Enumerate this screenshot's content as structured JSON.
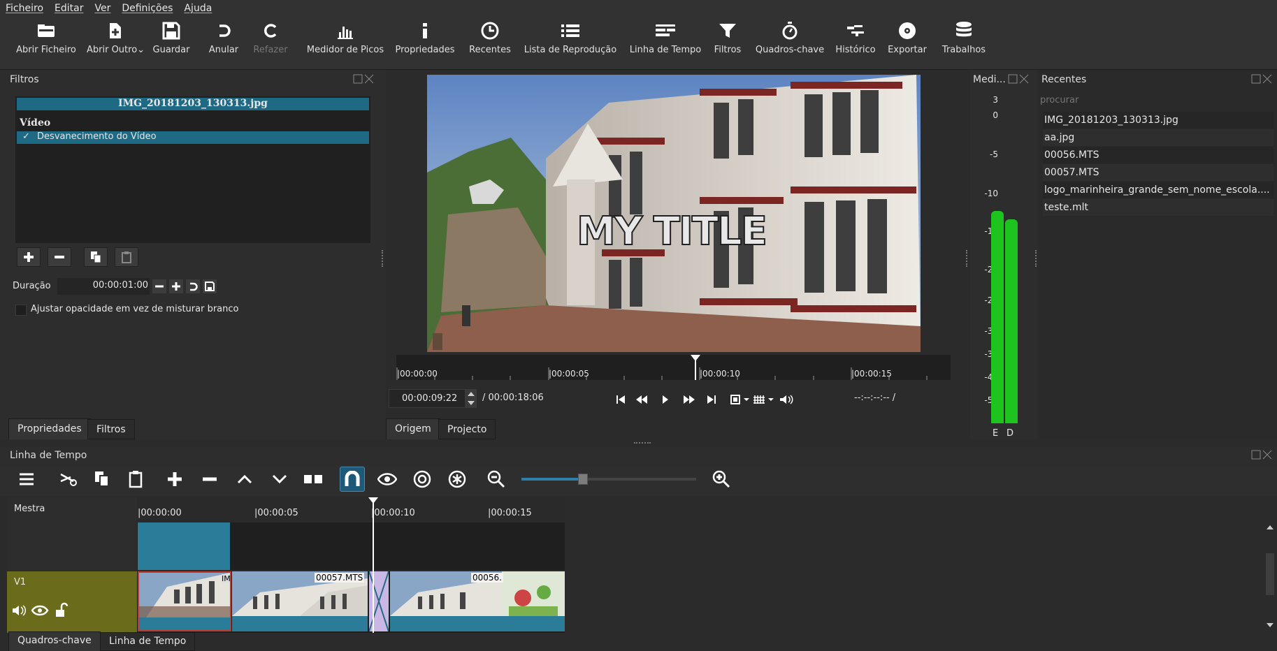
{
  "menu": [
    "Ficheiro",
    "Editar",
    "Ver",
    "Definições",
    "Ajuda"
  ],
  "toolbar": {
    "open_file": "Abrir Ficheiro",
    "open_other": "Abrir Outro",
    "save": "Guardar",
    "undo": "Anular",
    "redo": "Refazer",
    "peak_meter": "Medidor de Picos",
    "properties": "Propriedades",
    "recent": "Recentes",
    "playlist": "Lista de Reprodução",
    "timeline": "Linha de Tempo",
    "filters": "Filtros",
    "keyframes": "Quadros-chave",
    "history": "Histórico",
    "export": "Exportar",
    "jobs": "Trabalhos"
  },
  "filters_panel": {
    "title": "Filtros",
    "clip_name": "IMG_20181203_130313.jpg",
    "section": "Vídeo",
    "filter_item": "Desvanecimento do Vídeo",
    "check": "✓",
    "duration_label": "Duração",
    "duration_value": "00:00:01:00",
    "opacity_option": "Ajustar opacidade em vez de misturar branco",
    "tabs": [
      "Propriedades",
      "Filtros"
    ]
  },
  "player": {
    "title_overlay": "MY TITLE",
    "ruler_labels": [
      "|00:00:00",
      "|00:00:05",
      "|00:00:10",
      "|00:00:15"
    ],
    "position": "00:00:09:22",
    "duration": "/ 00:00:18:06",
    "in_out": "--:--:--:-- /",
    "playhead_fraction": 0.54,
    "tabs": [
      "Origem",
      "Projecto"
    ]
  },
  "meter": {
    "title": "Medi...",
    "scale": [
      "3",
      "0",
      "-5",
      "-10",
      "-15",
      "-20",
      "-25",
      "-30",
      "-35",
      "-40",
      "-50"
    ],
    "channels": [
      "E",
      "D"
    ],
    "color": "#22c322"
  },
  "recent_panel": {
    "title": "Recentes",
    "search_placeholder": "procurar",
    "items": [
      "IMG_20181203_130313.jpg",
      "aa.jpg",
      "00056.MTS",
      "00057.MTS",
      "logo_marinheira_grande_sem_nome_escola....",
      "teste.mlt"
    ]
  },
  "timeline": {
    "title": "Linha de Tempo",
    "master_label": "Mestra",
    "track_label": "V1",
    "ruler_labels": [
      "|00:00:00",
      "|00:00:05",
      "|00:00:10",
      "|00:00:15"
    ],
    "clips": [
      "IM",
      "00057.MTS",
      "00056."
    ],
    "zoom_fraction": 0.35
  },
  "bottom_tabs": [
    "Quadros-chave",
    "Linha de Tempo"
  ],
  "colors": {
    "accent": "#1e6a85",
    "track_yellow": "#6b6b1c",
    "meter_green": "#22c322"
  }
}
